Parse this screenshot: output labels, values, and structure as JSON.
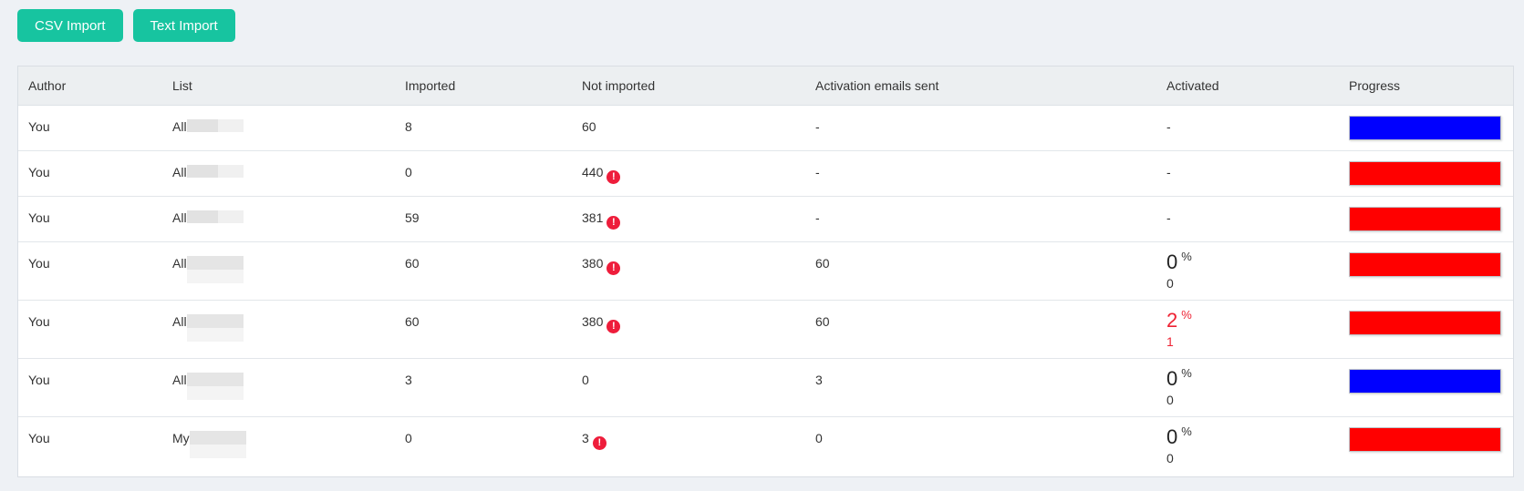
{
  "toolbar": {
    "csv_label": "CSV Import",
    "text_label": "Text Import"
  },
  "colors": {
    "accent": "#17c4a0",
    "ok": "#0000ff",
    "bad": "#ff0000",
    "danger": "#ee2233"
  },
  "table": {
    "headers": [
      "Author",
      "List",
      "Imported",
      "Not imported",
      "Activation emails sent",
      "Activated",
      "Progress"
    ],
    "rows": [
      {
        "author": "You",
        "list": "All",
        "imported": "8",
        "not_imported": "60",
        "warn": false,
        "sent": "-",
        "activated": "-",
        "progress": "blue"
      },
      {
        "author": "You",
        "list": "All",
        "imported": "0",
        "not_imported": "440",
        "warn": true,
        "sent": "-",
        "activated": "-",
        "progress": "red"
      },
      {
        "author": "You",
        "list": "All",
        "imported": "59",
        "not_imported": "381",
        "warn": true,
        "sent": "-",
        "activated": "-",
        "progress": "red"
      },
      {
        "author": "You",
        "list": "All",
        "imported": "60",
        "not_imported": "380",
        "warn": true,
        "sent": "60",
        "activated_pct": "0",
        "pct_sign": "%",
        "activated_count": "0",
        "danger": false,
        "progress": "red"
      },
      {
        "author": "You",
        "list": "All",
        "imported": "60",
        "not_imported": "380",
        "warn": true,
        "sent": "60",
        "activated_pct": "2",
        "pct_sign": "%",
        "activated_count": "1",
        "danger": true,
        "progress": "red"
      },
      {
        "author": "You",
        "list": "All",
        "imported": "3",
        "not_imported": "0",
        "warn": false,
        "sent": "3",
        "activated_pct": "0",
        "pct_sign": "%",
        "activated_count": "0",
        "danger": false,
        "progress": "blue"
      },
      {
        "author": "You",
        "list": "My",
        "imported": "0",
        "not_imported": "3",
        "warn": true,
        "sent": "0",
        "activated_pct": "0",
        "pct_sign": "%",
        "activated_count": "0",
        "danger": false,
        "progress": "red"
      }
    ],
    "warn_glyph": "!"
  }
}
